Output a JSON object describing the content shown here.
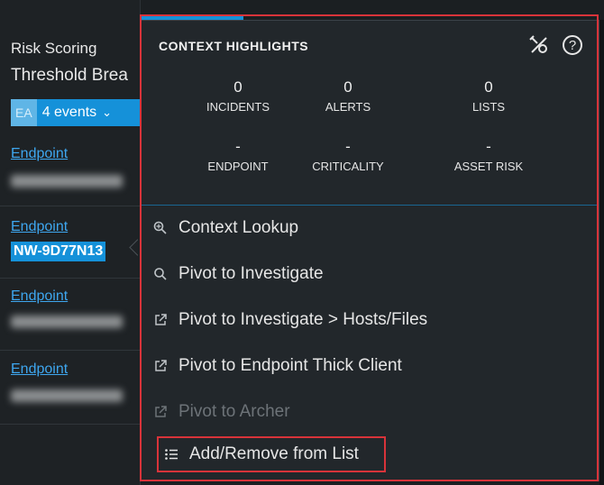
{
  "left": {
    "risk_label": "Risk Scoring",
    "threshold_label": "Threshold Brea",
    "events_badge": "EA",
    "events_label": "4 events",
    "endpoint_link": "Endpoint",
    "selected_host": "NW-9D77N13"
  },
  "context": {
    "title": "CONTEXT HIGHLIGHTS",
    "stats_row1": [
      {
        "value": "0",
        "label": "INCIDENTS"
      },
      {
        "value": "0",
        "label": "ALERTS"
      },
      {
        "value": "0",
        "label": "LISTS"
      }
    ],
    "stats_row2": [
      {
        "value": "-",
        "label": "ENDPOINT"
      },
      {
        "value": "-",
        "label": "CRITICALITY"
      },
      {
        "value": "-",
        "label": "ASSET RISK"
      }
    ],
    "menu": [
      {
        "label": "Context Lookup",
        "icon": "context-lookup-icon",
        "enabled": true
      },
      {
        "label": "Pivot to Investigate",
        "icon": "search-icon",
        "enabled": true
      },
      {
        "label": "Pivot to Investigate > Hosts/Files",
        "icon": "external-link-icon",
        "enabled": true
      },
      {
        "label": "Pivot to Endpoint Thick Client",
        "icon": "external-link-icon",
        "enabled": true
      },
      {
        "label": "Pivot to Archer",
        "icon": "external-link-icon",
        "enabled": false
      },
      {
        "label": "Add/Remove from List",
        "icon": "list-icon",
        "enabled": true
      }
    ]
  },
  "colors": {
    "accent": "#1591d9",
    "highlight": "#d8333a",
    "link": "#3ea7f0"
  }
}
